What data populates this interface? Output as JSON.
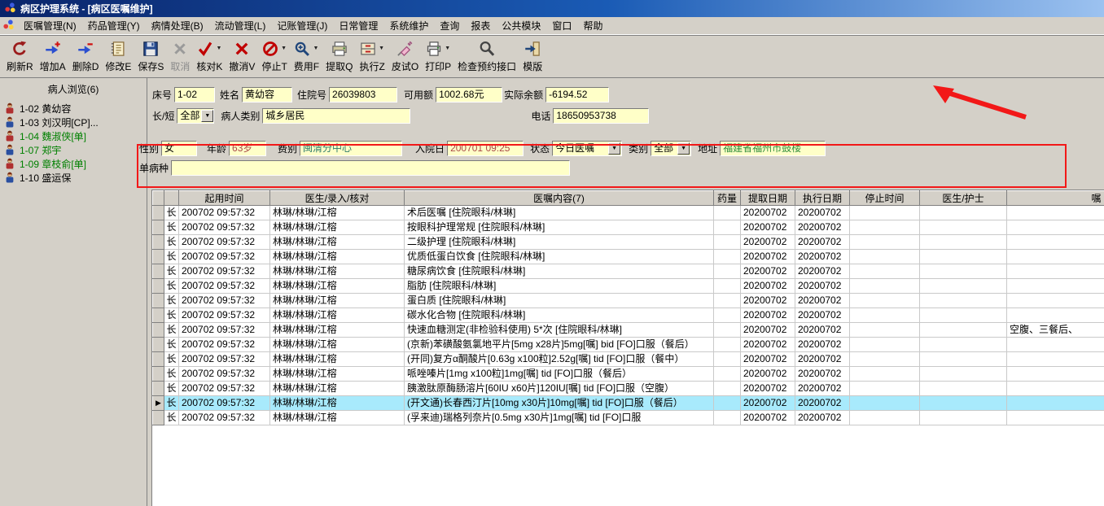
{
  "window": {
    "title": "病区护理系统 - [病区医嘱维护]"
  },
  "menu": {
    "items": [
      "医嘱管理(N)",
      "药品管理(Y)",
      "病情处理(B)",
      "流动管理(L)",
      "记账管理(J)",
      "日常管理",
      "系统维护",
      "查询",
      "报表",
      "公共模块",
      "窗口",
      "帮助"
    ]
  },
  "toolbar": {
    "buttons": [
      {
        "label": "刷新R",
        "icon": "refresh-icon"
      },
      {
        "label": "增加A",
        "icon": "add-icon"
      },
      {
        "label": "删除D",
        "icon": "delete-icon"
      },
      {
        "label": "修改E",
        "icon": "modify-icon"
      },
      {
        "label": "保存S",
        "icon": "save-icon"
      },
      {
        "label": "取消",
        "icon": "cancel-icon",
        "disabled": true
      },
      {
        "label": "核对K",
        "icon": "check-icon",
        "dropdown": true
      },
      {
        "label": "撤消V",
        "icon": "undo-icon"
      },
      {
        "label": "停止T",
        "icon": "stop-icon",
        "dropdown": true
      },
      {
        "label": "费用F",
        "icon": "fee-icon",
        "dropdown": true
      },
      {
        "label": "提取Q",
        "icon": "extract-icon"
      },
      {
        "label": "执行Z",
        "icon": "execute-icon",
        "dropdown": true
      },
      {
        "label": "皮试O",
        "icon": "skin-test-icon"
      },
      {
        "label": "打印P",
        "icon": "print-icon",
        "dropdown": true
      },
      {
        "label": "检查预约接口",
        "icon": "interface-icon"
      },
      {
        "label": "模版",
        "icon": "template-icon"
      }
    ]
  },
  "sidebar": {
    "title": "病人浏览(6)",
    "patients": [
      {
        "label": "1-02 黄幼容",
        "color": "black"
      },
      {
        "label": "1-03 刘汉明[CP]...",
        "color": "black"
      },
      {
        "label": "1-04 魏淑侠[单]",
        "color": "green"
      },
      {
        "label": "1-07 郑宇",
        "color": "green"
      },
      {
        "label": "1-09 章枝俞[单]",
        "color": "green"
      },
      {
        "label": "1-10 盛运保",
        "color": "black"
      }
    ]
  },
  "patient_form": {
    "bed_label": "床号",
    "bed": "1-02",
    "name_label": "姓名",
    "name": "黄幼容",
    "admission_no_label": "住院号",
    "admission_no": "26039803",
    "available_label": "可用额",
    "available": "1002.68元",
    "balance_label": "实际余额",
    "balance": "-6194.52",
    "duration_label": "长/短",
    "duration": "全部",
    "patient_type_label": "病人类别",
    "patient_type": "城乡居民",
    "phone_label": "电话",
    "phone": "18650953738",
    "gender_label": "性别",
    "gender": "女",
    "age_label": "年龄",
    "age": "63岁",
    "fee_type_label": "费别",
    "fee_type": "闽清分中心",
    "admit_date_label": "入院日",
    "admit_date": "200701 09:25",
    "status_label": "状态",
    "status": "今日医嘱",
    "category_label": "类别",
    "category": "全部",
    "address_label": "地址",
    "address": "福建省福州市鼓楼",
    "disease_label": "单病种",
    "disease": ""
  },
  "orders": {
    "headers": [
      "起用时间",
      "医生/录入/核对",
      "医嘱内容(7)",
      "药量",
      "提取日期",
      "执行日期",
      "停止时间",
      "医生/护士",
      "嘱"
    ],
    "rows": [
      {
        "type": "长",
        "start": "200702 09:57:32",
        "doctors": "林琳/林琳/江榕",
        "content": "术后医嘱  [住院眼科/林琳]",
        "dose": "",
        "extract": "20200702",
        "exec": "20200702",
        "stop": "",
        "nurse": "",
        "remark": "",
        "selected": false
      },
      {
        "type": "长",
        "start": "200702 09:57:32",
        "doctors": "林琳/林琳/江榕",
        "content": "按眼科护理常规  [住院眼科/林琳]",
        "dose": "",
        "extract": "20200702",
        "exec": "20200702",
        "stop": "",
        "nurse": "",
        "remark": "",
        "selected": false
      },
      {
        "type": "长",
        "start": "200702 09:57:32",
        "doctors": "林琳/林琳/江榕",
        "content": "二级护理  [住院眼科/林琳]",
        "dose": "",
        "extract": "20200702",
        "exec": "20200702",
        "stop": "",
        "nurse": "",
        "remark": "",
        "selected": false
      },
      {
        "type": "长",
        "start": "200702 09:57:32",
        "doctors": "林琳/林琳/江榕",
        "content": "优质低蛋白饮食  [住院眼科/林琳]",
        "dose": "",
        "extract": "20200702",
        "exec": "20200702",
        "stop": "",
        "nurse": "",
        "remark": "",
        "selected": false
      },
      {
        "type": "长",
        "start": "200702 09:57:32",
        "doctors": "林琳/林琳/江榕",
        "content": "糖尿病饮食  [住院眼科/林琳]",
        "dose": "",
        "extract": "20200702",
        "exec": "20200702",
        "stop": "",
        "nurse": "",
        "remark": "",
        "selected": false
      },
      {
        "type": "长",
        "start": "200702 09:57:32",
        "doctors": "林琳/林琳/江榕",
        "content": "脂肪  [住院眼科/林琳]",
        "dose": "",
        "extract": "20200702",
        "exec": "20200702",
        "stop": "",
        "nurse": "",
        "remark": "",
        "selected": false
      },
      {
        "type": "长",
        "start": "200702 09:57:32",
        "doctors": "林琳/林琳/江榕",
        "content": "蛋白质  [住院眼科/林琳]",
        "dose": "",
        "extract": "20200702",
        "exec": "20200702",
        "stop": "",
        "nurse": "",
        "remark": "",
        "selected": false
      },
      {
        "type": "长",
        "start": "200702 09:57:32",
        "doctors": "林琳/林琳/江榕",
        "content": "碳水化合物  [住院眼科/林琳]",
        "dose": "",
        "extract": "20200702",
        "exec": "20200702",
        "stop": "",
        "nurse": "",
        "remark": "",
        "selected": false
      },
      {
        "type": "长",
        "start": "200702 09:57:32",
        "doctors": "林琳/林琳/江榕",
        "content": "快速血糖测定(非检验科使用)  5*次 [住院眼科/林琳]",
        "dose": "",
        "extract": "20200702",
        "exec": "20200702",
        "stop": "",
        "nurse": "",
        "remark": "空腹、三餐后、",
        "selected": false
      },
      {
        "type": "长",
        "start": "200702 09:57:32",
        "doctors": "林琳/林琳/江榕",
        "content": "(京新)苯磺酸氨氯地平片[5mg x28片]5mg[嘱] bid [FO]口服（餐后）",
        "dose": "",
        "extract": "20200702",
        "exec": "20200702",
        "stop": "",
        "nurse": "",
        "remark": "",
        "selected": false
      },
      {
        "type": "长",
        "start": "200702 09:57:32",
        "doctors": "林琳/林琳/江榕",
        "content": "(开同)复方α酮酸片[0.63g x100粒]2.52g[嘱] tid [FO]口服（餐中）",
        "dose": "",
        "extract": "20200702",
        "exec": "20200702",
        "stop": "",
        "nurse": "",
        "remark": "",
        "selected": false
      },
      {
        "type": "长",
        "start": "200702 09:57:32",
        "doctors": "林琳/林琳/江榕",
        "content": "哌唑嗪片[1mg x100粒]1mg[嘱] tid [FO]口服（餐后）",
        "dose": "",
        "extract": "20200702",
        "exec": "20200702",
        "stop": "",
        "nurse": "",
        "remark": "",
        "selected": false
      },
      {
        "type": "长",
        "start": "200702 09:57:32",
        "doctors": "林琳/林琳/江榕",
        "content": "胰激肽原酶肠溶片[60IU x60片]120IU[嘱] tid [FO]口服（空腹）",
        "dose": "",
        "extract": "20200702",
        "exec": "20200702",
        "stop": "",
        "nurse": "",
        "remark": "",
        "selected": false
      },
      {
        "type": "长",
        "start": "200702 09:57:32",
        "doctors": "林琳/林琳/江榕",
        "content": "(开文通)长春西汀片[10mg x30片]10mg[嘱] tid [FO]口服（餐后）",
        "dose": "",
        "extract": "20200702",
        "exec": "20200702",
        "stop": "",
        "nurse": "",
        "remark": "",
        "selected": true
      },
      {
        "type": "长",
        "start": "200702 09:57:32",
        "doctors": "林琳/林琳/江榕",
        "content": "(孚来迪)瑞格列奈片[0.5mg x30片]1mg[嘱] tid [FO]口服",
        "dose": "",
        "extract": "20200702",
        "exec": "20200702",
        "stop": "",
        "nurse": "",
        "remark": "",
        "selected": false
      }
    ]
  },
  "colors": {
    "selected_row": "#a8eafc",
    "field_background": "#ffffc8",
    "annotation": "#f21818",
    "patient_green": "#008000"
  }
}
